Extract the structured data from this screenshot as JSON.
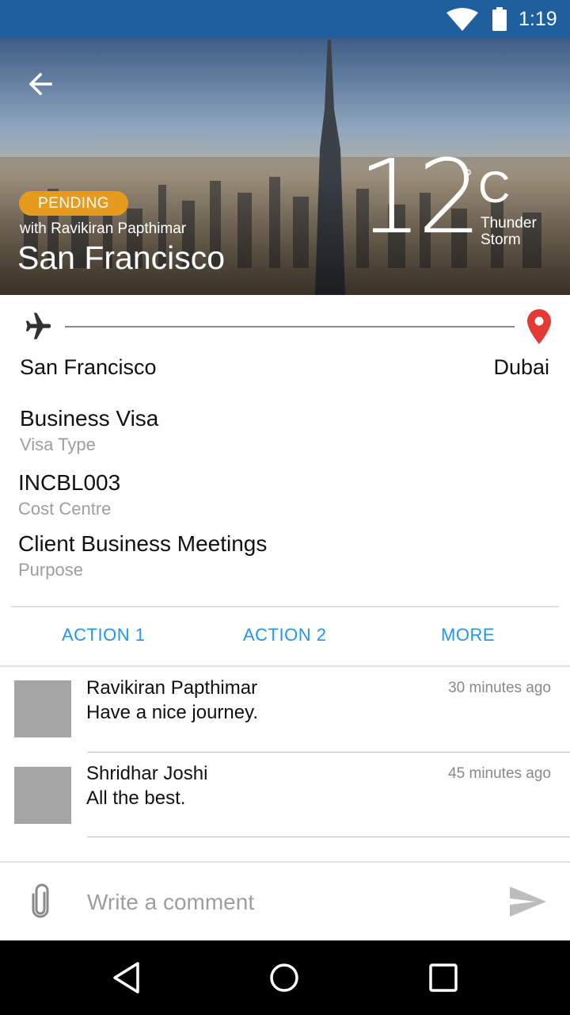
{
  "status_bar": {
    "time": "1:19",
    "icons": [
      "wifi-icon",
      "battery-icon"
    ]
  },
  "hero": {
    "back_icon": "arrow-left-icon",
    "status_badge": "PENDING",
    "with_text": "with Ravikiran Papthimar",
    "city": "San Francisco",
    "temperature": "12",
    "degree_symbol": "°",
    "unit": "C",
    "weather_line1": "Thunder",
    "weather_line2": "Storm",
    "badge_color": "#e79b1e"
  },
  "route": {
    "from": "San Francisco",
    "to": "Dubai",
    "from_icon": "airplane-icon",
    "to_icon": "map-pin-icon",
    "pin_color": "#e53935"
  },
  "details": [
    {
      "value": "Business Visa",
      "label": "Visa Type"
    },
    {
      "value": "INCBL003",
      "label": "Cost Centre"
    },
    {
      "value": "Client Business Meetings",
      "label": "Purpose"
    }
  ],
  "actions": [
    "ACTION 1",
    "ACTION 2",
    "MORE"
  ],
  "accent_color": "#2196f3",
  "comments": [
    {
      "name": "Ravikiran Papthimar",
      "text": "Have a nice journey.",
      "time": "30 minutes ago"
    },
    {
      "name": "Shridhar Joshi",
      "text": "All the best.",
      "time": "45 minutes ago"
    }
  ],
  "composer": {
    "placeholder": "Write a comment",
    "attach_icon": "paperclip-icon",
    "send_icon": "send-icon"
  },
  "nav_bar": {
    "icons": [
      "nav-back-icon",
      "nav-home-icon",
      "nav-recents-icon"
    ]
  }
}
